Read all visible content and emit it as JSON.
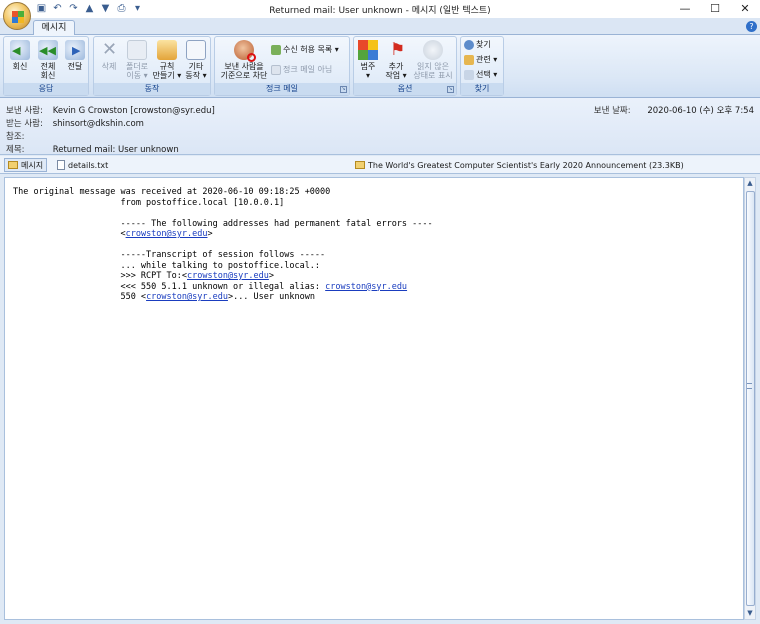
{
  "window": {
    "title": "Returned mail: User unknown - 메시지 (일반 텍스트)"
  },
  "tabs": [
    {
      "label": "메시지"
    }
  ],
  "ribbon": {
    "groups": [
      {
        "label": "응답",
        "buttons": [
          "회신",
          "전체\n회신",
          "전달"
        ]
      },
      {
        "label": "동작",
        "buttons": [
          "삭제",
          "폴더로\n이동 ▾",
          "규칙\n만들기 ▾",
          "기타\n동작 ▾"
        ]
      },
      {
        "label": "정크 메일",
        "buttons": [
          "보낸 사람을\n기준으로 차단"
        ],
        "small": [
          "수신 허용 목록 ▾",
          "정크 메일 아님"
        ]
      },
      {
        "label": "옵션",
        "buttons": [
          "범주\n▾",
          "추가\n작업 ▾",
          "읽지 않은\n상태로 표시"
        ]
      },
      {
        "label": "찾기",
        "small": [
          "찾기",
          "관련 ▾",
          "선택 ▾"
        ]
      }
    ]
  },
  "header": {
    "from_label": "보낸 사람:",
    "from_value": "Kevin G Crowston [crowston@syr.edu]",
    "to_label": "받는 사람:",
    "to_value": "shinsort@dkshin.com",
    "cc_label": "참조:",
    "cc_value": "",
    "subject_label": "제목:",
    "subject_value": "Returned mail: User unknown",
    "sent_label": "보낸 날짜:",
    "sent_value": "2020-06-10 (수) 오후 7:54"
  },
  "attachments": [
    {
      "name": "메시지",
      "type": "envelope",
      "selected": true
    },
    {
      "name": "details.txt",
      "type": "document",
      "selected": false
    },
    {
      "name": "The World's Greatest Computer Scientist's Early 2020 Announcement (23.3KB)",
      "type": "envelope",
      "selected": false
    }
  ],
  "body": {
    "l1": "The original message was received at 2020-06-10 09:18:25 +0000",
    "l2": "                     from postoffice.local [10.0.0.1]",
    "l3": "                     ----- The following addresses had permanent fatal errors ----",
    "l4_pre": "                     <",
    "l4_link": "crowston@syr.edu",
    "l4_post": ">",
    "l5": "                     -----Transcript of session follows -----",
    "l6": "                     ... while talking to postoffice.local.:",
    "l7_pre": "                     >>> RCPT To:<",
    "l7_link": "crowston@syr.edu",
    "l7_post": ">",
    "l8_pre": "                     <<< 550 5.1.1 unknown or illegal alias: ",
    "l8_link": "crowston@syr.edu",
    "l9_pre": "                     550 <",
    "l9_link": "crowston@syr.edu",
    "l9_post": ">... User unknown"
  },
  "colors": {
    "accent": "#15428b",
    "link": "#1a3dbf",
    "ribbon_bg": "#dbe7f6"
  }
}
